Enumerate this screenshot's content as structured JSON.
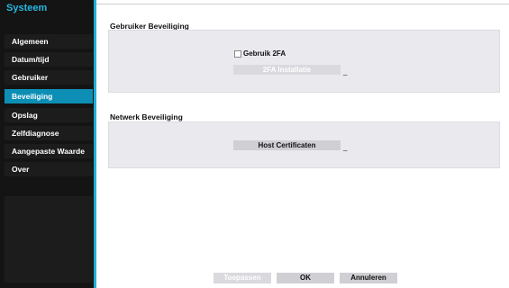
{
  "sidebar": {
    "title": "Systeem",
    "items": [
      {
        "label": "Algemeen",
        "active": false
      },
      {
        "label": "Datum/tijd",
        "active": false
      },
      {
        "label": "Gebruiker",
        "active": false
      },
      {
        "label": "Beveiliging",
        "active": true
      },
      {
        "label": "Opslag",
        "active": false
      },
      {
        "label": "Zelfdiagnose",
        "active": false
      },
      {
        "label": "Aangepaste Waarde",
        "active": false
      },
      {
        "label": "Over",
        "active": false
      }
    ]
  },
  "user_security": {
    "title": "Gebruiker Beveiliging",
    "use_2fa_label": "Gebruik 2FA",
    "use_2fa_checked": false,
    "setup_2fa_label": "2FA Installatie",
    "setup_2fa_suffix": "_"
  },
  "network_security": {
    "title": "Netwerk Beveiliging",
    "host_cert_label": "Host Certificaten",
    "host_cert_suffix": "_"
  },
  "footer": {
    "apply_label": "Toepassen",
    "ok_label": "OK",
    "cancel_label": "Annuleren"
  },
  "colors": {
    "sidebar_bg": "#141414",
    "accent": "#1fb0d6",
    "active_item": "#0d8fb5",
    "panel_bg": "#e9e9ee"
  }
}
